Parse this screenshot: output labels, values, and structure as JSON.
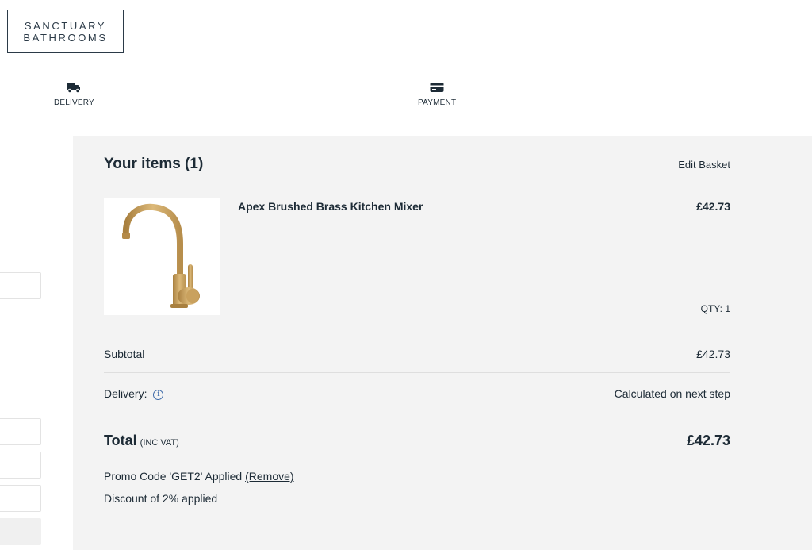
{
  "brand": {
    "line1": "SANCTUARY",
    "line2": "BATHROOMS"
  },
  "steps": [
    {
      "label": "DELIVERY",
      "icon": "truck-icon"
    },
    {
      "label": "PAYMENT",
      "icon": "credit-card-icon"
    }
  ],
  "summary": {
    "title": "Your items (1)",
    "edit_basket": "Edit Basket",
    "items": [
      {
        "name": "Apex Brushed Brass Kitchen Mixer",
        "price": "£42.73",
        "qty": "QTY: 1",
        "image": "kitchen-mixer-tap"
      }
    ],
    "subtotal_label": "Subtotal",
    "subtotal_value": "£42.73",
    "delivery_label": "Delivery:",
    "delivery_value": "Calculated on next step",
    "total_label": "Total",
    "total_sub": "(INC VAT)",
    "total_value": "£42.73",
    "promo_text": "Promo Code 'GET2' Applied",
    "promo_remove": "(Remove)",
    "discount_text": "Discount of 2% applied"
  },
  "colors": {
    "text": "#1d2b36",
    "panel_bg": "#f3f3f3",
    "brass": "#c9a15e",
    "info_blue": "#3d6aa8"
  }
}
